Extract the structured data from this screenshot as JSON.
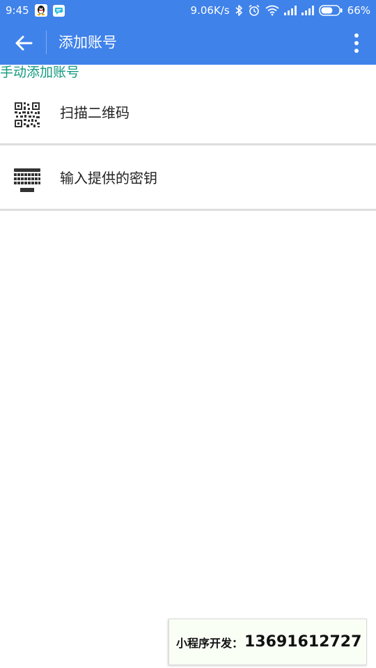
{
  "status_bar": {
    "time": "9:45",
    "net_speed": "9.06K/s",
    "battery": "66%",
    "battery_level": 0.66
  },
  "toolbar": {
    "title": "添加账号"
  },
  "section": {
    "header": "手动添加账号"
  },
  "list": {
    "items": [
      {
        "label": "扫描二维码",
        "icon": "qr-code-icon"
      },
      {
        "label": "输入提供的密钥",
        "icon": "keyboard-icon"
      }
    ]
  },
  "promo": {
    "label": "小程序开发：",
    "number": "13691612727"
  },
  "colors": {
    "primary": "#3f82ea",
    "section_header": "#12997f",
    "divider": "#dddddd"
  }
}
